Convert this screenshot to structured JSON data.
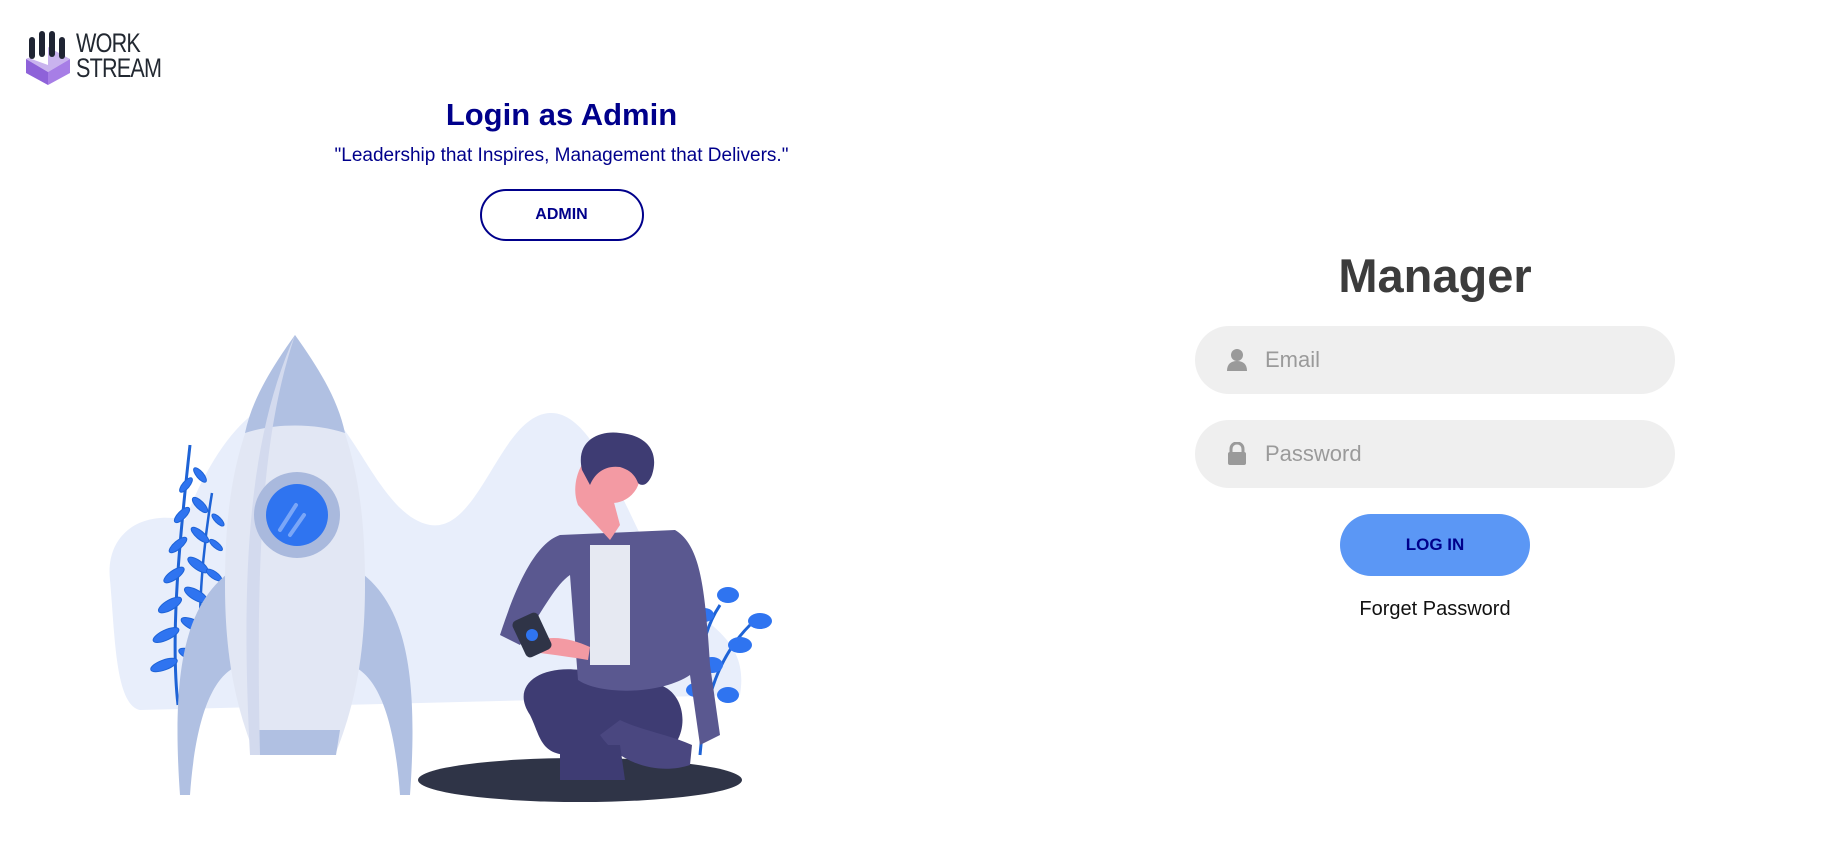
{
  "brand": {
    "logo_line1": "WORK",
    "logo_line2": "STREAM",
    "logo_icon": "hexagon-cube-logo"
  },
  "admin_section": {
    "title": "Login as Admin",
    "quote": "\"Leadership that Inspires, Management that Delivers.\"",
    "button_label": "ADMIN"
  },
  "illustration": {
    "subject": "rocket-and-person-illustration"
  },
  "login_form": {
    "title": "Manager",
    "email": {
      "placeholder": "Email",
      "value": "",
      "icon": "user-icon"
    },
    "password": {
      "placeholder": "Password",
      "value": "",
      "icon": "lock-icon"
    },
    "submit_label": "LOG IN",
    "forgot_label": "Forget Password"
  },
  "colors": {
    "accent_dark": "#00008b",
    "button_blue": "#5b97f5",
    "field_bg": "#efefef",
    "title_gray": "#3c3c3c"
  }
}
